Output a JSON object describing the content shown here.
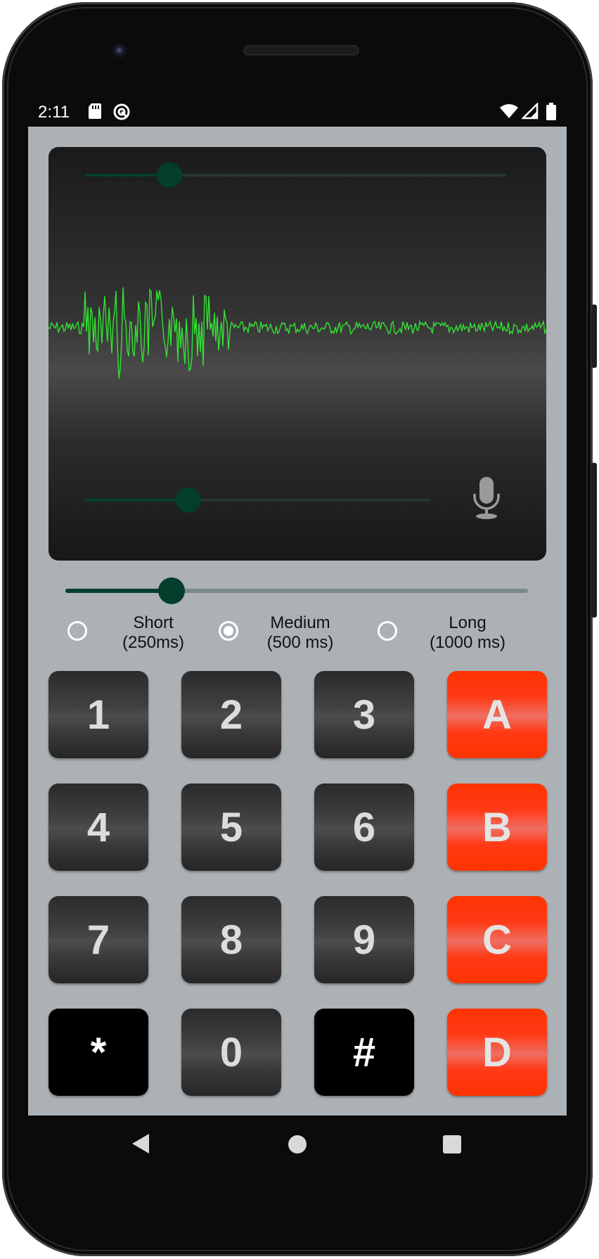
{
  "status_bar": {
    "time": "2:11",
    "icons": [
      "sd-card-icon",
      "sync-icon",
      "wifi-icon",
      "signal-icon",
      "battery-icon"
    ]
  },
  "oscilloscope": {
    "top_slider_level": 0.2,
    "bottom_slider_level": 0.3,
    "mic_icon": "microphone-icon",
    "wave_color": "#33e233"
  },
  "duration_slider_level": 0.23,
  "duration_options": [
    {
      "line1": "Short",
      "line2": "(250ms)",
      "selected": false
    },
    {
      "line1": "Medium",
      "line2": "(500 ms)",
      "selected": true
    },
    {
      "line1": "Long",
      "line2": "(1000 ms)",
      "selected": false
    }
  ],
  "keypad": [
    [
      "1",
      "2",
      "3",
      "A"
    ],
    [
      "4",
      "5",
      "6",
      "B"
    ],
    [
      "7",
      "8",
      "9",
      "C"
    ],
    [
      "*",
      "0",
      "#",
      "D"
    ]
  ],
  "colors": {
    "screen_bg": "#abb1b5",
    "letter_key": "#ff3300",
    "digit_key": "#3c3c3c",
    "accent": "#033d2b"
  },
  "navigation": {
    "back": "back-icon",
    "home": "home-icon",
    "recents": "recents-icon"
  }
}
